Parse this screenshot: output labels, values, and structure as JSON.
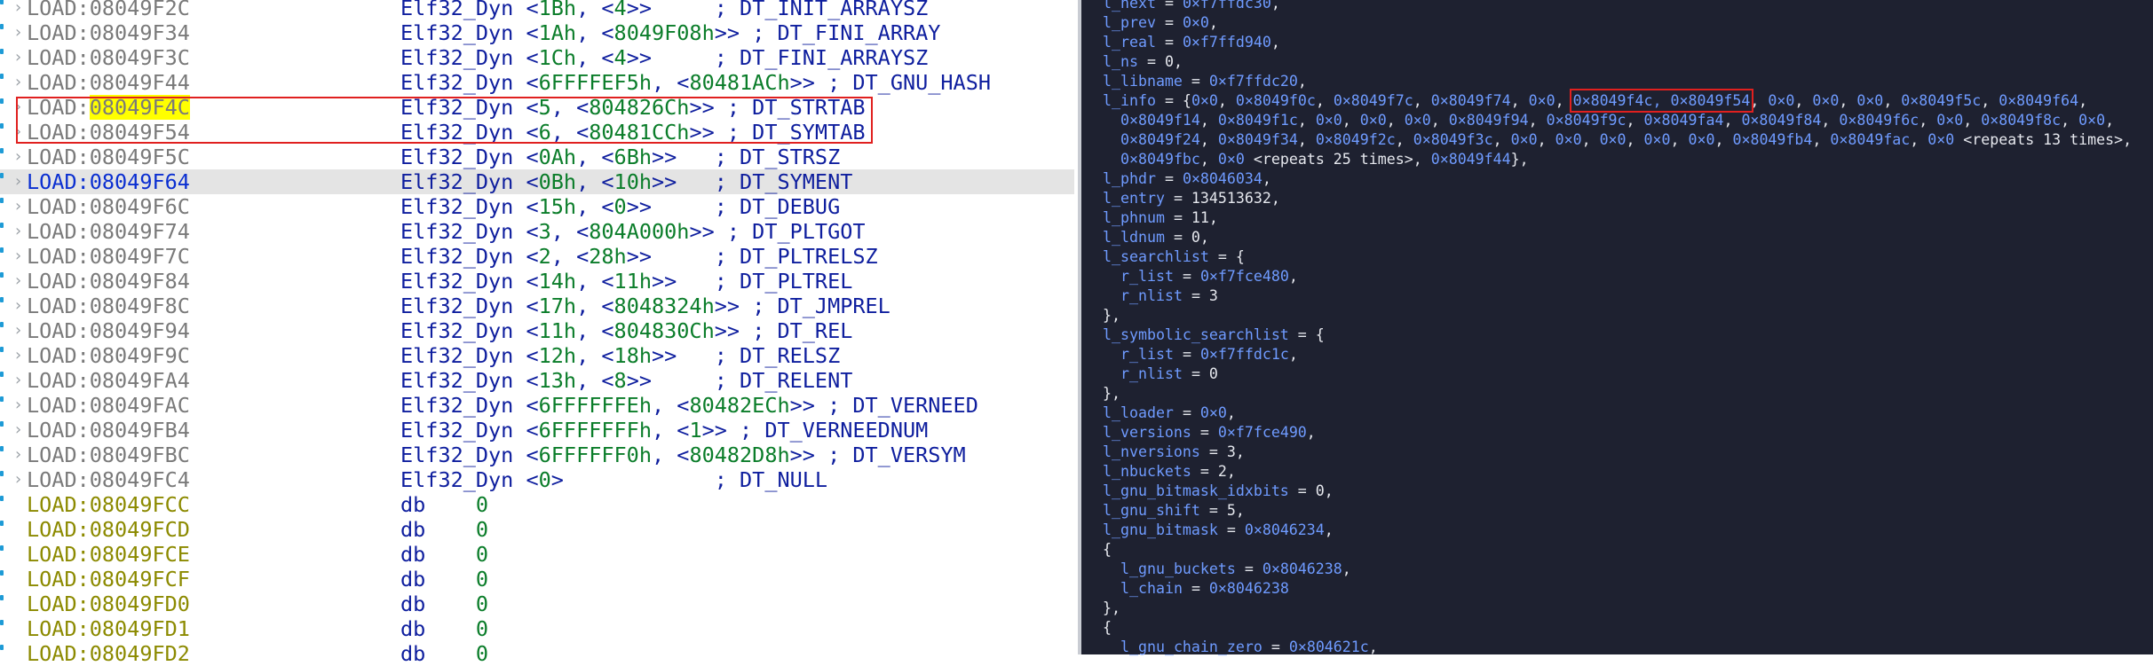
{
  "listing": [
    {
      "addr": "LOAD:08049F2C",
      "instr": "Elf32_Dyn <1Bh, <4>>     ; DT_INIT_ARRAYSZ",
      "kind": "dyn"
    },
    {
      "addr": "LOAD:08049F34",
      "instr": "Elf32_Dyn <1Ah, <8049F08h>> ; DT_FINI_ARRAY",
      "kind": "dyn"
    },
    {
      "addr": "LOAD:08049F3C",
      "instr": "Elf32_Dyn <1Ch, <4>>     ; DT_FINI_ARRAYSZ",
      "kind": "dyn"
    },
    {
      "addr": "LOAD:08049F44",
      "instr": "Elf32_Dyn <6FFFFEF5h, <80481ACh>> ; DT_GNU_HASH",
      "kind": "dyn"
    },
    {
      "addr_prefix": "LOAD:",
      "addr_hl": "08049F4C",
      "instr": "Elf32_Dyn <5, <804826Ch>> ; DT_STRTAB",
      "kind": "dyn"
    },
    {
      "addr": "LOAD:08049F54",
      "instr": "Elf32_Dyn <6, <80481CCh>> ; DT_SYMTAB",
      "kind": "dyn"
    },
    {
      "addr": "LOAD:08049F5C",
      "instr": "Elf32_Dyn <0Ah, <6Bh>>   ; DT_STRSZ",
      "kind": "dyn"
    },
    {
      "addr": "LOAD:08049F64",
      "instr": "Elf32_Dyn <0Bh, <10h>>   ; DT_SYMENT",
      "kind": "dyn",
      "selected": true
    },
    {
      "addr": "LOAD:08049F6C",
      "instr": "Elf32_Dyn <15h, <0>>     ; DT_DEBUG",
      "kind": "dyn"
    },
    {
      "addr": "LOAD:08049F74",
      "instr": "Elf32_Dyn <3, <804A000h>> ; DT_PLTGOT",
      "kind": "dyn"
    },
    {
      "addr": "LOAD:08049F7C",
      "instr": "Elf32_Dyn <2, <28h>>     ; DT_PLTRELSZ",
      "kind": "dyn"
    },
    {
      "addr": "LOAD:08049F84",
      "instr": "Elf32_Dyn <14h, <11h>>   ; DT_PLTREL",
      "kind": "dyn"
    },
    {
      "addr": "LOAD:08049F8C",
      "instr": "Elf32_Dyn <17h, <8048324h>> ; DT_JMPREL",
      "kind": "dyn"
    },
    {
      "addr": "LOAD:08049F94",
      "instr": "Elf32_Dyn <11h, <804830Ch>> ; DT_REL",
      "kind": "dyn"
    },
    {
      "addr": "LOAD:08049F9C",
      "instr": "Elf32_Dyn <12h, <18h>>   ; DT_RELSZ",
      "kind": "dyn"
    },
    {
      "addr": "LOAD:08049FA4",
      "instr": "Elf32_Dyn <13h, <8>>     ; DT_RELENT",
      "kind": "dyn"
    },
    {
      "addr": "LOAD:08049FAC",
      "instr": "Elf32_Dyn <6FFFFFFEh, <80482ECh>> ; DT_VERNEED",
      "kind": "dyn"
    },
    {
      "addr": "LOAD:08049FB4",
      "instr": "Elf32_Dyn <6FFFFFFFh, <1>> ; DT_VERNEEDNUM",
      "kind": "dyn"
    },
    {
      "addr": "LOAD:08049FBC",
      "instr": "Elf32_Dyn <6FFFFFF0h, <80482D8h>> ; DT_VERSYM",
      "kind": "dyn"
    },
    {
      "addr": "LOAD:08049FC4",
      "instr": "Elf32_Dyn <0>            ; DT_NULL",
      "kind": "dyn"
    },
    {
      "addr": "LOAD:08049FCC",
      "instr": "db    0",
      "kind": "db"
    },
    {
      "addr": "LOAD:08049FCD",
      "instr": "db    0",
      "kind": "db"
    },
    {
      "addr": "LOAD:08049FCE",
      "instr": "db    0",
      "kind": "db"
    },
    {
      "addr": "LOAD:08049FCF",
      "instr": "db    0",
      "kind": "db"
    },
    {
      "addr": "LOAD:08049FD0",
      "instr": "db    0",
      "kind": "db"
    },
    {
      "addr": "LOAD:08049FD1",
      "instr": "db    0",
      "kind": "db"
    },
    {
      "addr": "LOAD:08049FD2",
      "instr": "db    0",
      "kind": "db"
    }
  ],
  "gdb": [
    {
      "k": "l_next",
      "v": "= 0×f7ffdc30,"
    },
    {
      "k": "l_prev",
      "v": "= 0×0,"
    },
    {
      "k": "l_real",
      "v": "= 0×f7ffd940,"
    },
    {
      "k": "l_ns",
      "v": "= 0,"
    },
    {
      "k": "l_libname",
      "v": "= 0×f7ffdc20,"
    },
    {
      "k": "l_info",
      "v": "= {0×0, 0×8049f0c, 0×8049f7c, 0×8049f74, 0×0, ",
      "box": "0×8049f4c, 0×8049f54",
      "tail": ", 0×0, 0×0, 0×0, 0×8049f5c, 0×8049f64,"
    },
    {
      "ind": true,
      "v": "0×8049f14, 0×8049f1c, 0×0, 0×0, 0×0, 0×8049f94, 0×8049f9c, 0×8049fa4, 0×8049f84, 0×8049f6c, 0×0, 0×8049f8c, 0×0,"
    },
    {
      "ind": true,
      "v": "0×8049f24, 0×8049f34, 0×8049f2c, 0×8049f3c, 0×0, 0×0, 0×0, 0×0, 0×0, 0×8049fb4, 0×8049fac, 0×0 ",
      "note": "<repeats 13 times>,"
    },
    {
      "ind": true,
      "v": "0×8049fbc, 0×0 ",
      "note": "<repeats 25 times>,",
      "tail": " 0×8049f44},"
    },
    {
      "k": "l_phdr",
      "v": "= 0×8046034,"
    },
    {
      "k": "l_entry",
      "v": "= 134513632,"
    },
    {
      "k": "l_phnum",
      "v": "= 11,"
    },
    {
      "k": "l_ldnum",
      "v": "= 0,"
    },
    {
      "k": "l_searchlist",
      "v": "= {"
    },
    {
      "ind": true,
      "k": "r_list",
      "v": "= 0×f7fce480,"
    },
    {
      "ind": true,
      "k": "r_nlist",
      "v": "= 3"
    },
    {
      "v": "},"
    },
    {
      "k": "l_symbolic_searchlist",
      "v": "= {"
    },
    {
      "ind": true,
      "k": "r_list",
      "v": "= 0×f7ffdc1c,"
    },
    {
      "ind": true,
      "k": "r_nlist",
      "v": "= 0"
    },
    {
      "v": "},"
    },
    {
      "k": "l_loader",
      "v": "= 0×0,"
    },
    {
      "k": "l_versions",
      "v": "= 0×f7fce490,"
    },
    {
      "k": "l_nversions",
      "v": "= 3,"
    },
    {
      "k": "l_nbuckets",
      "v": "= 2,"
    },
    {
      "k": "l_gnu_bitmask_idxbits",
      "v": "= 0,"
    },
    {
      "k": "l_gnu_shift",
      "v": "= 5,"
    },
    {
      "k": "l_gnu_bitmask",
      "v": "= 0×8046234,"
    },
    {
      "v": "{"
    },
    {
      "ind": true,
      "k": "l_gnu_buckets",
      "v": "= 0×8046238,"
    },
    {
      "ind": true,
      "k": "l_chain",
      "v": "= 0×8046238"
    },
    {
      "v": "},"
    },
    {
      "v": "{"
    },
    {
      "ind": true,
      "k": "l_gnu_chain_zero",
      "v": "= 0×804621c,"
    }
  ]
}
